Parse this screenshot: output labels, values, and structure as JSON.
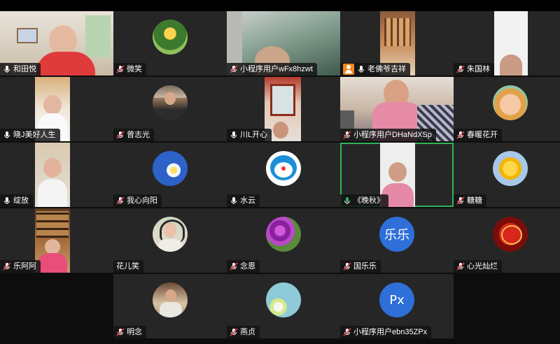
{
  "meeting": {
    "participants": [
      {
        "name": "和田悦",
        "mic": "unmuted"
      },
      {
        "name": "微笑",
        "mic": "muted"
      },
      {
        "name": "小程序用户wFx8hzwt",
        "mic": "muted"
      },
      {
        "name": "老佛爷吉祥",
        "mic": "unmuted"
      },
      {
        "name": "朱国林",
        "mic": "muted"
      },
      {
        "name": "晓J美好人生",
        "mic": "unmuted"
      },
      {
        "name": "曾志光",
        "mic": "muted"
      },
      {
        "name": "川L开心",
        "mic": "unmuted"
      },
      {
        "name": "小程序用户DHaNdXSp",
        "mic": "muted"
      },
      {
        "name": "春暖花开",
        "mic": "muted"
      },
      {
        "name": "绽放",
        "mic": "unmuted"
      },
      {
        "name": "我心向阳",
        "mic": "muted"
      },
      {
        "name": "水云",
        "mic": "unmuted"
      },
      {
        "name": "《晚秋》",
        "mic": "speaking"
      },
      {
        "name": "糖糖",
        "mic": "muted"
      },
      {
        "name": "乐阿阿",
        "mic": "muted"
      },
      {
        "name": "花儿笑",
        "mic": "none"
      },
      {
        "name": "念恩",
        "mic": "muted"
      },
      {
        "name": "国乐乐",
        "mic": "muted"
      },
      {
        "name": "心光灿烂",
        "mic": "muted"
      },
      {
        "name": "明念",
        "mic": "muted"
      },
      {
        "name": "燕贞",
        "mic": "muted"
      },
      {
        "name": "小程序用户ebn35ZPx",
        "mic": "muted"
      }
    ],
    "text_avatars": {
      "guolele": "乐乐",
      "px": "Px"
    },
    "colors": {
      "speaking_border": "#2fb35a",
      "tile_bg": "#262626",
      "text_avatar_bg": "#2e6fd9",
      "host_badge": "#f08a24"
    }
  }
}
